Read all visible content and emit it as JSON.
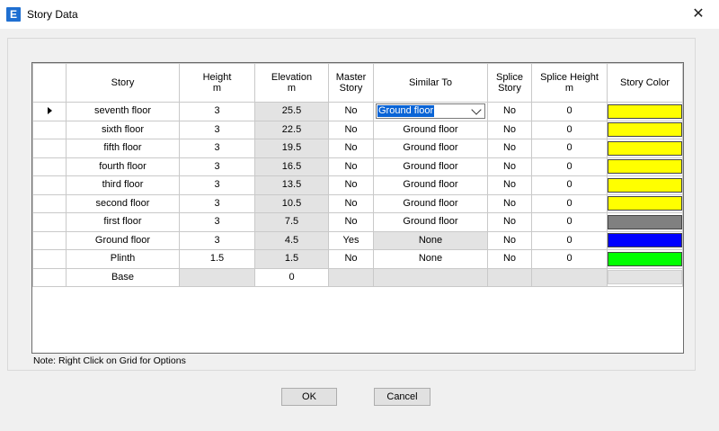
{
  "window": {
    "title": "Story Data",
    "icon_letter": "E",
    "close_glyph": "✕"
  },
  "grid": {
    "headers": {
      "story": "Story",
      "height": "Height",
      "height_unit": "m",
      "elevation": "Elevation",
      "elevation_unit": "m",
      "master": "Master",
      "master2": "Story",
      "similar": "Similar To",
      "splice": "Splice",
      "splice2": "Story",
      "splice_height": "Splice Height",
      "splice_height_unit": "m",
      "color": "Story Color"
    },
    "rows": [
      {
        "story": "seventh floor",
        "height": "3",
        "elevation": "25.5",
        "master": "No",
        "similar": "Ground floor",
        "splice": "No",
        "splice_height": "0",
        "color": "#ffff00"
      },
      {
        "story": "sixth floor",
        "height": "3",
        "elevation": "22.5",
        "master": "No",
        "similar": "Ground floor",
        "splice": "No",
        "splice_height": "0",
        "color": "#ffff00"
      },
      {
        "story": "fifth floor",
        "height": "3",
        "elevation": "19.5",
        "master": "No",
        "similar": "Ground floor",
        "splice": "No",
        "splice_height": "0",
        "color": "#ffff00"
      },
      {
        "story": "fourth floor",
        "height": "3",
        "elevation": "16.5",
        "master": "No",
        "similar": "Ground floor",
        "splice": "No",
        "splice_height": "0",
        "color": "#ffff00"
      },
      {
        "story": "third floor",
        "height": "3",
        "elevation": "13.5",
        "master": "No",
        "similar": "Ground floor",
        "splice": "No",
        "splice_height": "0",
        "color": "#ffff00"
      },
      {
        "story": "second floor",
        "height": "3",
        "elevation": "10.5",
        "master": "No",
        "similar": "Ground floor",
        "splice": "No",
        "splice_height": "0",
        "color": "#ffff00"
      },
      {
        "story": "first floor",
        "height": "3",
        "elevation": "7.5",
        "master": "No",
        "similar": "Ground floor",
        "splice": "No",
        "splice_height": "0",
        "color": "#808080"
      },
      {
        "story": "Ground floor",
        "height": "3",
        "elevation": "4.5",
        "master": "Yes",
        "similar": "None",
        "splice": "No",
        "splice_height": "0",
        "color": "#0000ff"
      },
      {
        "story": "Plinth",
        "height": "1.5",
        "elevation": "1.5",
        "master": "No",
        "similar": "None",
        "splice": "No",
        "splice_height": "0",
        "color": "#00ff00"
      },
      {
        "story": "Base",
        "height": "",
        "elevation": "0",
        "master": "",
        "similar": "",
        "splice": "",
        "splice_height": "",
        "color": ""
      }
    ]
  },
  "note": "Note:  Right Click on Grid for Options",
  "buttons": {
    "ok": "OK",
    "cancel": "Cancel"
  }
}
